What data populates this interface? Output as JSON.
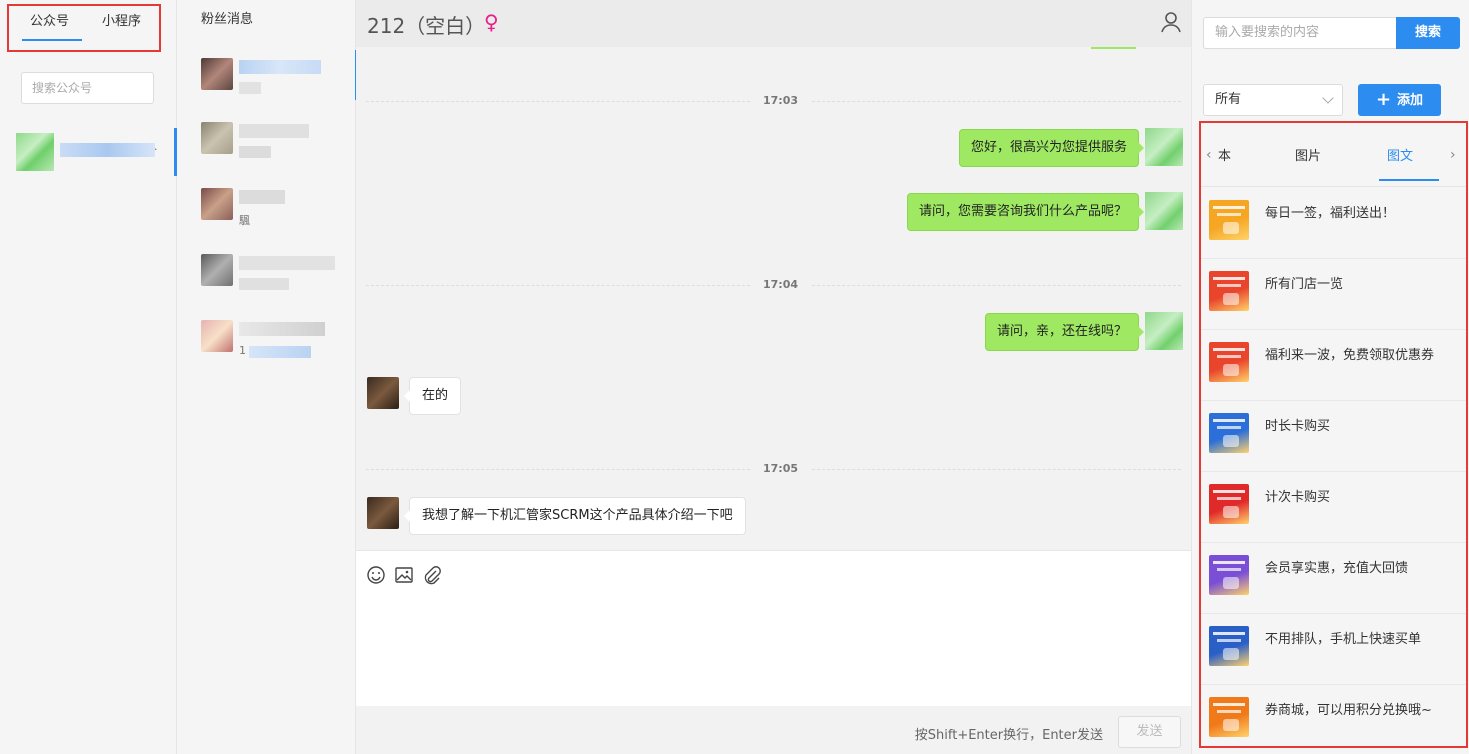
{
  "accounts": {
    "tabs": [
      "公众号",
      "小程序"
    ],
    "search_placeholder": "搜索公众号",
    "item_suffix": "·"
  },
  "fans": {
    "title": "粉丝消息",
    "row2_char": "颿",
    "row5_char": "1"
  },
  "chat": {
    "title": "212（空白）",
    "female_symbol": "♀",
    "messages": [
      {
        "type": "time",
        "text": "17:03"
      },
      {
        "type": "out",
        "text": "您好，很高兴为您提供服务"
      },
      {
        "type": "out",
        "text": "请问，您需要咨询我们什么产品呢？"
      },
      {
        "type": "time",
        "text": "17:04"
      },
      {
        "type": "out",
        "text": "请问，亲，还在线吗？"
      },
      {
        "type": "in",
        "text": "在的"
      },
      {
        "type": "time",
        "text": "17:05"
      },
      {
        "type": "in",
        "text": "我想了解一下机汇管家SCRM这个产品具体介绍一下吧"
      }
    ],
    "hint": "按Shift+Enter换行，Enter发送",
    "send_label": "发送"
  },
  "materials": {
    "search_placeholder": "输入要搜索的内容",
    "search_label": "搜索",
    "filter_value": "所有",
    "add_label": "添加",
    "tabs": [
      "本",
      "图片",
      "图文"
    ],
    "active_tab": "图文",
    "items": [
      {
        "title": "每日一签，福利送出！",
        "color": "#f5a623"
      },
      {
        "title": "所有门店一览",
        "color": "#e8452c"
      },
      {
        "title": "福利来一波，免费领取优惠券",
        "color": "#e8452c"
      },
      {
        "title": "时长卡购买",
        "color": "#2d6fd8"
      },
      {
        "title": "计次卡购买",
        "color": "#e02a2a"
      },
      {
        "title": "会员享实惠，充值大回馈",
        "color": "#7a4fd6"
      },
      {
        "title": "不用排队，手机上快速买单",
        "color": "#2a5fc8"
      },
      {
        "title": "券商城，可以用积分兑换哦~",
        "color": "#f07a1a"
      }
    ]
  }
}
